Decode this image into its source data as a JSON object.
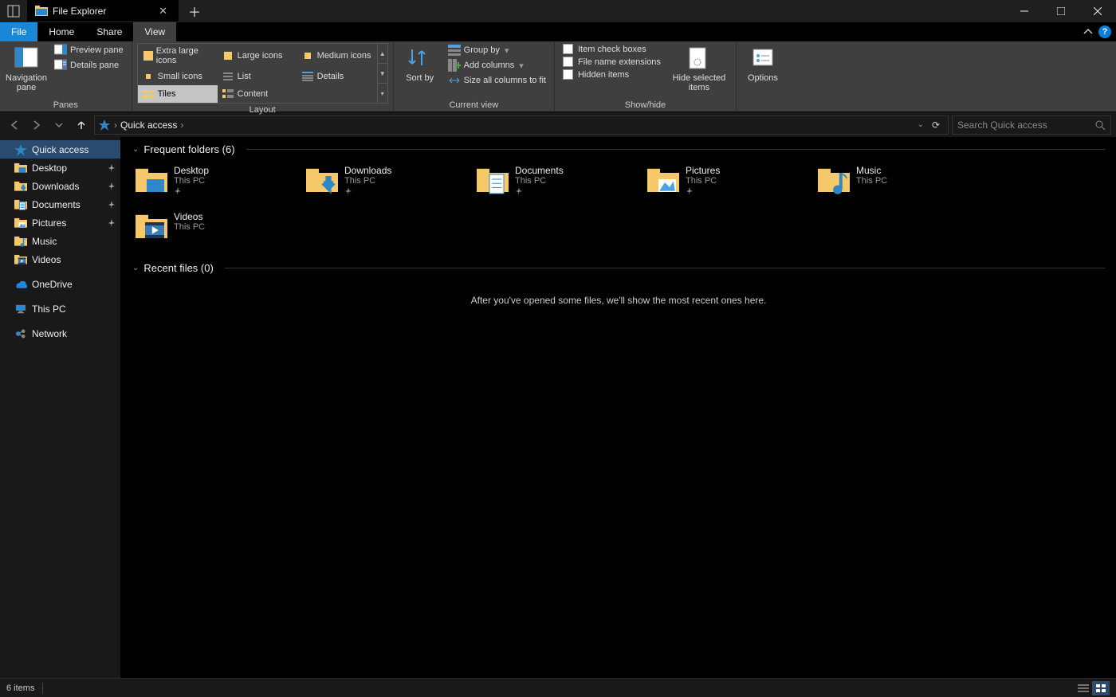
{
  "window": {
    "app_title": "File Explorer"
  },
  "menu": {
    "file": "File",
    "home": "Home",
    "share": "Share",
    "view": "View"
  },
  "ribbon": {
    "panes": {
      "navigation_pane": "Navigation pane",
      "preview_pane": "Preview pane",
      "details_pane": "Details pane",
      "caption": "Panes"
    },
    "layout": {
      "options": [
        "Extra large icons",
        "Large icons",
        "Medium icons",
        "Small icons",
        "List",
        "Details",
        "Tiles",
        "Content"
      ],
      "selected": "Tiles",
      "caption": "Layout"
    },
    "current_view": {
      "sort_by": "Sort by",
      "group_by": "Group by",
      "add_columns": "Add columns",
      "size_all": "Size all columns to fit",
      "caption": "Current view"
    },
    "show_hide": {
      "item_check_boxes": "Item check boxes",
      "file_name_extensions": "File name extensions",
      "hidden_items": "Hidden items",
      "hide_selected": "Hide selected items",
      "caption": "Show/hide"
    },
    "options": "Options"
  },
  "nav": {
    "location": "Quick access",
    "search_placeholder": "Search Quick access"
  },
  "sidebar": {
    "items": [
      {
        "label": "Quick access",
        "icon": "star",
        "selected": true
      },
      {
        "label": "Desktop",
        "icon": "desktop",
        "pinned": true
      },
      {
        "label": "Downloads",
        "icon": "downloads",
        "pinned": true
      },
      {
        "label": "Documents",
        "icon": "documents",
        "pinned": true
      },
      {
        "label": "Pictures",
        "icon": "pictures",
        "pinned": true
      },
      {
        "label": "Music",
        "icon": "music"
      },
      {
        "label": "Videos",
        "icon": "videos"
      },
      {
        "label": "_sep"
      },
      {
        "label": "OneDrive",
        "icon": "onedrive"
      },
      {
        "label": "_sep"
      },
      {
        "label": "This PC",
        "icon": "thispc"
      },
      {
        "label": "_sep"
      },
      {
        "label": "Network",
        "icon": "network"
      }
    ]
  },
  "content": {
    "frequent": {
      "header": "Frequent folders (6)",
      "tiles": [
        {
          "name": "Desktop",
          "location": "This PC",
          "icon": "desktop",
          "pinned": true
        },
        {
          "name": "Downloads",
          "location": "This PC",
          "icon": "downloads",
          "pinned": true
        },
        {
          "name": "Documents",
          "location": "This PC",
          "icon": "documents",
          "pinned": true
        },
        {
          "name": "Pictures",
          "location": "This PC",
          "icon": "pictures",
          "pinned": true
        },
        {
          "name": "Music",
          "location": "This PC",
          "icon": "music"
        },
        {
          "name": "Videos",
          "location": "This PC",
          "icon": "videos"
        }
      ]
    },
    "recent": {
      "header": "Recent files (0)",
      "empty_message": "After you've opened some files, we'll show the most recent ones here."
    }
  },
  "status": {
    "item_count": "6 items"
  }
}
